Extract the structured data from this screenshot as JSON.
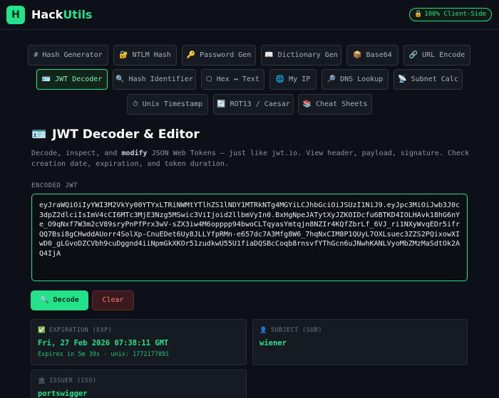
{
  "header": {
    "logo_letter": "H",
    "brand_prefix": "Hack",
    "brand_suffix": "Utils",
    "badge_icon": "lock-icon",
    "badge_label": "100% Client-Side",
    "brand_color": "#22e38a"
  },
  "nav": {
    "row1": [
      {
        "icon": "#",
        "label": "Hash Generator"
      },
      {
        "icon": "🔐",
        "label": "NTLM Hash"
      },
      {
        "icon": "🔑",
        "label": "Password Gen"
      },
      {
        "icon": "📖",
        "label": "Dictionary Gen"
      },
      {
        "icon": "📦",
        "label": "Base64"
      },
      {
        "icon": "🔗",
        "label": "URL Encode"
      }
    ],
    "row2": [
      {
        "icon": "🪪",
        "label": "JWT Decoder"
      },
      {
        "icon": "🔍",
        "label": "Hash Identifier"
      },
      {
        "icon": "⬡",
        "label": "Hex ↔ Text"
      },
      {
        "icon": "🌐",
        "label": "My IP"
      },
      {
        "icon": "🔎",
        "label": "DNS Lookup"
      },
      {
        "icon": "📡",
        "label": "Subnet Calc"
      }
    ],
    "row3": [
      {
        "icon": "⏱",
        "label": "Unix Timestamp"
      },
      {
        "icon": "🔄",
        "label": "ROT13 / Caesar"
      },
      {
        "icon": "📚",
        "label": "Cheat Sheets"
      }
    ],
    "active": "JWT Decoder"
  },
  "tool": {
    "icon": "🪪",
    "title": "JWT Decoder & Editor",
    "desc_pre": "Decode, inspect, and ",
    "desc_bold": "modify",
    "desc_post": " JSON Web Tokens — just like jwt.io. View header, payload, signature. Check creation date, expiration, and token duration.",
    "input_label": "ENCODED JWT",
    "token": "eyJraWQiOiIyYWI3M2VkYy00YTYxLTRiNWMtYTlhZS1lNDY1MTRkNTg4MGYiLCJhbGciOiJSUzI1NiJ9.eyJpc3MiOiJwb3J0c3dpZ2dlciIsImV4cCI6MTc3MjE3Nzg5MSwic3ViIjoid2llbmVyIn0.BxHgNpeJATytXyJZKOIDcfu6BTKD4IOLHAvk18hG6nYe_O9qNxf7W3m2cV89sryPnPfPrx3wV-sZX3iw4M6opppp94bwoCLTqyasYmtqjn8NZIr4KQfZbrLf_6VJ_ri1NXyWvqEDr5ifrQQ7Bsi8gCHwddAUorr4SolXp-CnuEDet6Uy8JLLYfpRMn-e657dc7A3Mfg8W6_7hqNxCIM8P1QUyL7OXLsuec3ZZS2PQixowXIwD0_gLGvoDZCVbh9cuDggnd4iiNpmGkXKOr51zudkwU55U1fiaDQSBcCoqb8rnsvfYThGcn6uJNwhKANLVyoMbZMzMaSdtOk2AQ4IjA",
    "decode_label": "Decode",
    "decode_icon": "🔍",
    "clear_label": "Clear"
  },
  "cards": {
    "expiration": {
      "icon": "✅",
      "label": "EXPIRATION (EXP)",
      "value": "Fri, 27 Feb 2026 07:38:11 GMT",
      "sub": "Expires in 5m 39s · unix: 1772177891"
    },
    "subject": {
      "icon": "👤",
      "label": "SUBJECT (SUB)",
      "value": "wiener"
    },
    "issuer": {
      "icon": "🏛",
      "label": "ISSUER (ISS)",
      "value": "portswigger"
    }
  }
}
